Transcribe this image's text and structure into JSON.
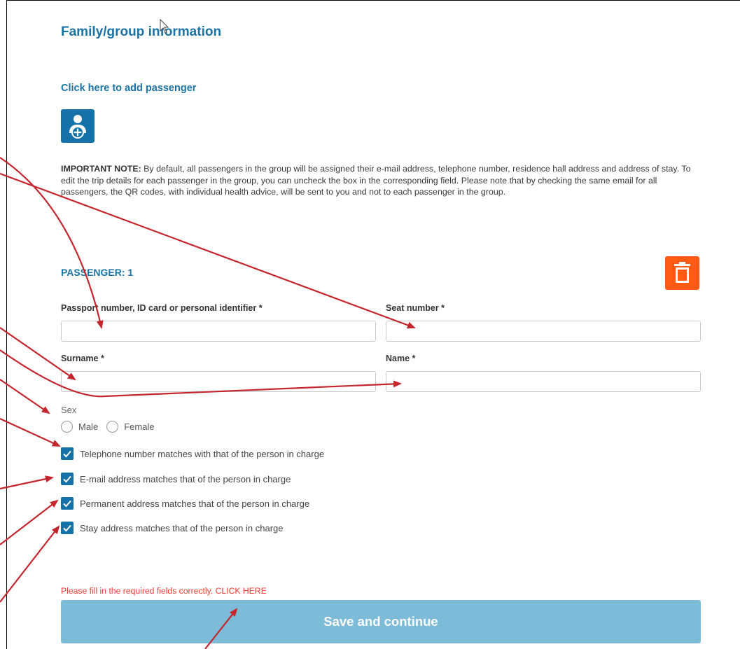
{
  "section": {
    "title": "Family/group information"
  },
  "add_passenger": {
    "link_text": "Click here to add passenger",
    "icon": "add-person-icon"
  },
  "note": {
    "prefix": "IMPORTANT NOTE:",
    "text": " By default, all passengers in the group will be assigned their e-mail address, telephone number, residence hall address and address of stay. To edit the trip details for each passenger in the group, you can uncheck the box in the corresponding field. Please note that by checking the same email for all passengers, the QR codes, with individual health advice, will be sent to you and not to each passenger in the group."
  },
  "passenger": {
    "title": "PASSENGER: 1",
    "delete_icon": "trash-icon",
    "fields": {
      "passport_label": "Passport number, ID card or personal identifier *",
      "seat_label": "Seat number *",
      "surname_label": "Surname *",
      "name_label": "Name *"
    },
    "sex": {
      "label": "Sex",
      "options": [
        "Male",
        "Female"
      ]
    },
    "checks": [
      {
        "label": "Telephone number matches with that of the person in charge",
        "checked": true
      },
      {
        "label": "E-mail address matches that of the person in charge",
        "checked": true
      },
      {
        "label": "Permanent address matches that of the person in charge",
        "checked": true
      },
      {
        "label": "Stay address matches that of the person in charge",
        "checked": true
      }
    ]
  },
  "error_message": "Please fill in the required fields correctly. CLICK HERE",
  "save_button": "Save and continue",
  "colors": {
    "primary_blue": "#1a72a5",
    "delete_orange": "#ff5a13",
    "save_disabled": "#7cbcd8",
    "error_red": "#ee3b33",
    "annotation_arrow": "#c4262e"
  }
}
